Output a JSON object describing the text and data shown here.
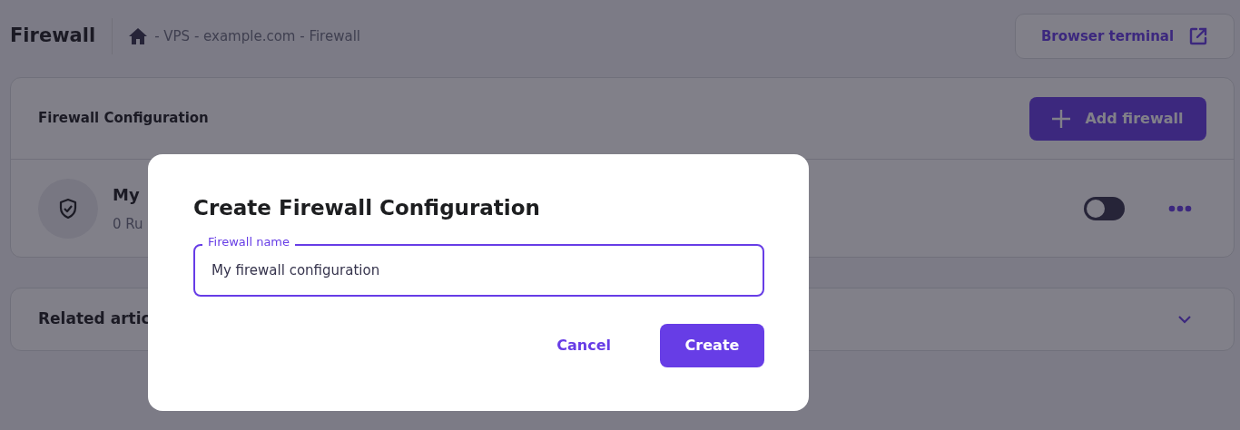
{
  "header": {
    "title": "Firewall",
    "breadcrumb": "- VPS - example.com - Firewall",
    "terminal_button": "Browser terminal"
  },
  "config_card": {
    "title": "Firewall Configuration",
    "add_button": "Add firewall",
    "rows": [
      {
        "name": "My",
        "rules": "0 Ru",
        "toggle": {
          "on": false
        }
      }
    ]
  },
  "related_card": {
    "title": "Related artic",
    "expanded": false
  },
  "dialog": {
    "title": "Create Firewall Configuration",
    "field": {
      "label": "Firewall name",
      "value": "My firewall configuration"
    },
    "buttons": [
      {
        "label": "Cancel",
        "kind": "text"
      },
      {
        "label": "Create",
        "kind": "primary"
      }
    ]
  }
}
